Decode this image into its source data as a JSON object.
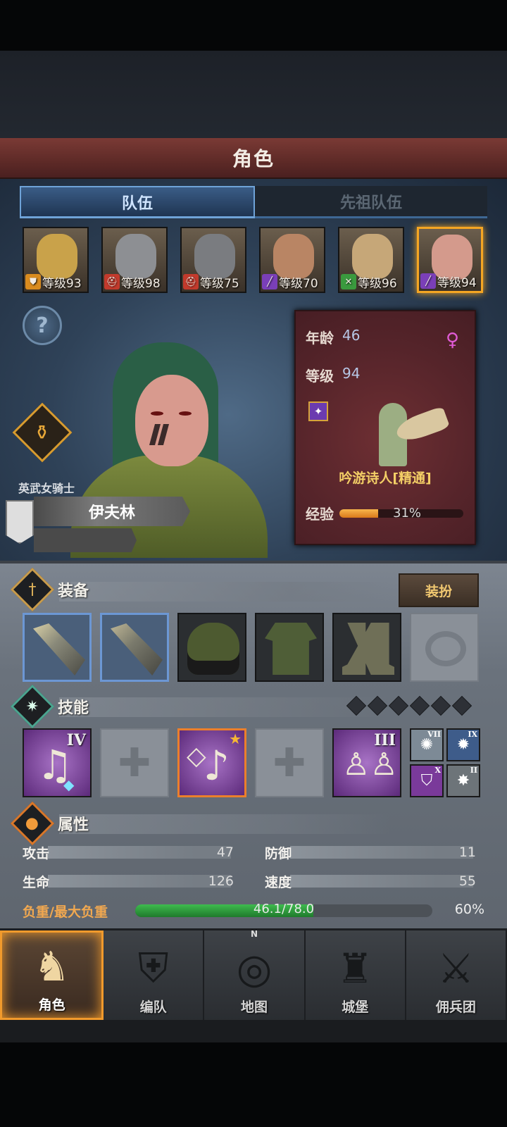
{
  "header": {
    "title": "角色"
  },
  "tabs": [
    {
      "label": "队伍",
      "active": true
    },
    {
      "label": "先祖队伍",
      "active": false
    }
  ],
  "roster": [
    {
      "level_label": "等级93",
      "class_icon": "shield-icon",
      "class_color": "#d98b1e",
      "face_color": "#c9a24a",
      "selected": false
    },
    {
      "level_label": "等级98",
      "class_icon": "helmet-icon",
      "class_color": "#c23a2c",
      "face_color": "#8d8f93",
      "selected": false
    },
    {
      "level_label": "等级75",
      "class_icon": "helmet-icon",
      "class_color": "#c23a2c",
      "face_color": "#7a7c80",
      "selected": false
    },
    {
      "level_label": "等级70",
      "class_icon": "wand-icon",
      "class_color": "#7a3fb8",
      "face_color": "#b98564",
      "selected": false
    },
    {
      "level_label": "等级96",
      "class_icon": "swords-icon",
      "class_color": "#3a9a3e",
      "face_color": "#c6a778",
      "selected": false
    },
    {
      "level_label": "等级94",
      "class_icon": "wand-icon",
      "class_color": "#7a3fb8",
      "face_color": "#d49a8c",
      "selected": true
    }
  ],
  "character": {
    "title": "英武女骑士",
    "name": "伊夫林",
    "age_label": "年龄",
    "age": "46",
    "level_label": "等级",
    "level": "94",
    "job": "吟游诗人[精通]",
    "exp_label": "经验",
    "exp_percent_text": "31%",
    "exp_fraction": 0.31
  },
  "equipment": {
    "title": "装备",
    "dress_button": "装扮",
    "slots": [
      {
        "name": "main-weapon",
        "highlight": "blue"
      },
      {
        "name": "off-weapon",
        "highlight": "blue"
      },
      {
        "name": "hood",
        "highlight": "none"
      },
      {
        "name": "tunic",
        "highlight": "none"
      },
      {
        "name": "boots",
        "highlight": "none"
      },
      {
        "name": "ring",
        "highlight": "empty"
      }
    ]
  },
  "skills": {
    "title": "技能",
    "diamond_count": 6,
    "main": [
      {
        "roman": "IV",
        "type": "song"
      },
      {
        "roman": "",
        "type": "empty"
      },
      {
        "roman": "",
        "type": "song-star"
      },
      {
        "roman": "",
        "type": "empty"
      },
      {
        "roman": "III",
        "type": "crowd"
      }
    ],
    "passives": [
      {
        "roman": "VII",
        "icon": "burst-icon",
        "color": "#7d8a96"
      },
      {
        "roman": "IX",
        "icon": "shatter-icon",
        "color": "#3e5c8a"
      },
      {
        "roman": "X",
        "icon": "shield-icon",
        "color": "#7a3a9a"
      },
      {
        "roman": "II",
        "icon": "explosion-icon",
        "color": "#6d7479"
      }
    ]
  },
  "attributes": {
    "title": "属性",
    "stats": [
      {
        "label": "攻击",
        "value": "47"
      },
      {
        "label": "防御",
        "value": "11"
      },
      {
        "label": "生命",
        "value": "126"
      },
      {
        "label": "速度",
        "value": "55"
      }
    ],
    "load_label": "负重/最大负重",
    "load_text": "46.1/78.0",
    "load_percent_text": "60%",
    "load_fraction": 0.6
  },
  "nav": [
    {
      "label": "角色",
      "icon": "knight-icon",
      "active": true
    },
    {
      "label": "编队",
      "icon": "formation-icon",
      "active": false
    },
    {
      "label": "地图",
      "icon": "compass-icon",
      "active": false,
      "compass_letter": "N"
    },
    {
      "label": "城堡",
      "icon": "castle-icon",
      "active": false
    },
    {
      "label": "佣兵团",
      "icon": "mercenary-icon",
      "active": false
    }
  ]
}
